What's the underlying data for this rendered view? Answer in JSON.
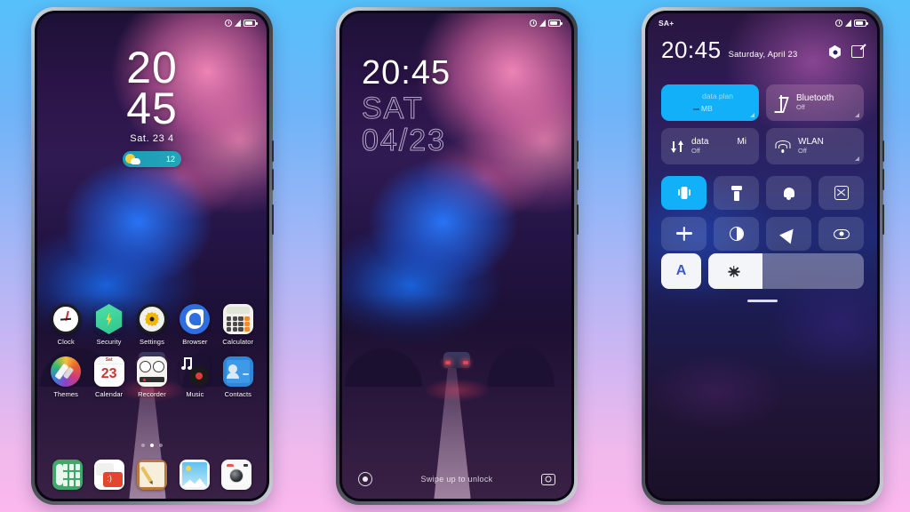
{
  "background": {
    "top_color": "#55c0fb",
    "bottom_color": "#fbb8ee"
  },
  "phone1": {
    "name": "home-screen",
    "statusbar": {
      "left": "",
      "icons": [
        "alarm-icon",
        "signal-icon",
        "battery-icon"
      ]
    },
    "clock_widget": {
      "hours": "20",
      "minutes": "45",
      "date": "Sat. 23 4"
    },
    "weather_widget": {
      "temp": "12",
      "icon": "sun-cloud-icon"
    },
    "apps_row1": [
      {
        "label": "Clock",
        "icon": "clock-app-icon"
      },
      {
        "label": "Security",
        "icon": "security-app-icon"
      },
      {
        "label": "Settings",
        "icon": "settings-app-icon"
      },
      {
        "label": "Browser",
        "icon": "browser-app-icon"
      },
      {
        "label": "Calculator",
        "icon": "calculator-app-icon"
      }
    ],
    "apps_row2": [
      {
        "label": "Themes",
        "icon": "themes-app-icon"
      },
      {
        "label": "Calendar",
        "icon": "calendar-app-icon",
        "day": "23",
        "weekday": "Sat"
      },
      {
        "label": "Recorder",
        "icon": "recorder-app-icon"
      },
      {
        "label": "Music",
        "icon": "music-app-icon"
      },
      {
        "label": "Contacts",
        "icon": "contacts-app-icon"
      }
    ],
    "page_dots": {
      "count": 3,
      "active_index": 1
    },
    "dock": [
      {
        "label": "Phone",
        "icon": "phone-app-icon"
      },
      {
        "label": "Messages",
        "icon": "messages-app-icon"
      },
      {
        "label": "Notes",
        "icon": "notes-app-icon"
      },
      {
        "label": "Gallery",
        "icon": "gallery-app-icon"
      },
      {
        "label": "Camera",
        "icon": "camera-app-icon"
      }
    ]
  },
  "phone2": {
    "name": "lock-screen",
    "time": "20:45",
    "weekday": "SAT",
    "date": "04/23",
    "hint": "Swipe up to unlock",
    "left_icon": "record-circle-icon",
    "right_icon": "camera-icon"
  },
  "phone3": {
    "name": "control-center",
    "statusbar": {
      "left": "SA+",
      "icons": [
        "alarm-icon",
        "signal-icon",
        "battery-icon"
      ]
    },
    "time": "20:45",
    "date": "Saturday, April 23",
    "header_icons": [
      {
        "name": "settings-hex-icon"
      },
      {
        "name": "edit-icon"
      }
    ],
    "big_tiles": [
      {
        "name": "data-plan",
        "title": "data plan",
        "value": "MB",
        "state": "active",
        "icon": ""
      },
      {
        "name": "bluetooth",
        "title": "Bluetooth",
        "sub": "Off",
        "state": "off",
        "icon": "bluetooth-icon"
      },
      {
        "name": "mobile-data",
        "title": "data",
        "extra": "Mi",
        "sub": "Off",
        "state": "off",
        "icon": "data-transfer-icon"
      },
      {
        "name": "wlan",
        "title": "WLAN",
        "sub": "Off",
        "state": "off",
        "icon": "wifi-icon"
      }
    ],
    "quick_icons_row1": [
      {
        "name": "vibrate",
        "icon": "vibrate-icon",
        "state": "active"
      },
      {
        "name": "flashlight",
        "icon": "flashlight-icon",
        "state": "off"
      },
      {
        "name": "ringer",
        "icon": "bell-icon",
        "state": "off"
      },
      {
        "name": "screenshot",
        "icon": "screenshot-icon",
        "state": "off"
      }
    ],
    "quick_icons_row2": [
      {
        "name": "airplane-mode",
        "icon": "airplane-icon",
        "state": "off"
      },
      {
        "name": "dark-mode",
        "icon": "contrast-icon",
        "state": "off"
      },
      {
        "name": "location",
        "icon": "location-arrow-icon",
        "state": "off"
      },
      {
        "name": "eye-comfort",
        "icon": "eye-icon",
        "state": "off"
      }
    ],
    "brightness": {
      "auto_label": "A",
      "icon": "sun-icon",
      "level_percent": 35
    },
    "handle": true
  }
}
